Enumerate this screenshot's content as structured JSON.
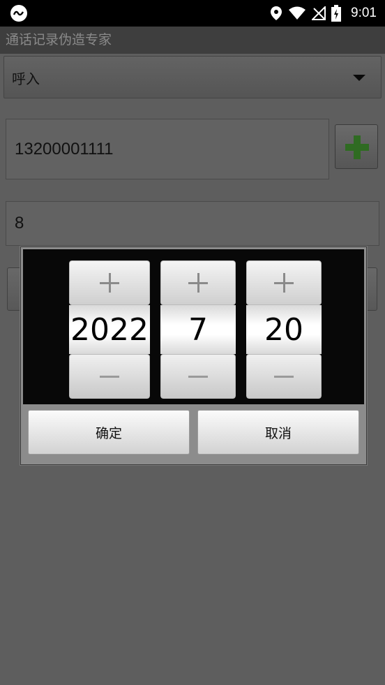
{
  "status_bar": {
    "time": "9:01",
    "icons": [
      "app-logo-icon",
      "location-icon",
      "wifi-icon",
      "no-signal-icon",
      "battery-charging-icon"
    ]
  },
  "app": {
    "title": "通话记录伪造专家"
  },
  "form": {
    "call_type": "呼入",
    "phone_number": "13200001111",
    "duration": "8"
  },
  "date_dialog": {
    "year": "2022",
    "month": "7",
    "day": "20",
    "ok_label": "确定",
    "cancel_label": "取消"
  },
  "colors": {
    "add_icon": "#2f6b22",
    "dim_overlay": "#5e5e5e"
  }
}
